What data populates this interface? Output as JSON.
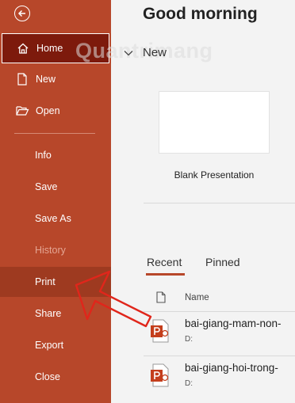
{
  "sidebar": {
    "items": [
      {
        "label": "Home"
      },
      {
        "label": "New"
      },
      {
        "label": "Open"
      },
      {
        "label": "Info"
      },
      {
        "label": "Save"
      },
      {
        "label": "Save As"
      },
      {
        "label": "History"
      },
      {
        "label": "Print"
      },
      {
        "label": "Share"
      },
      {
        "label": "Export"
      },
      {
        "label": "Close"
      }
    ]
  },
  "main": {
    "greeting": "Good morning",
    "watermark": "Quantrimang",
    "new_section": "New",
    "blank_label": "Blank Presentation",
    "tabs": [
      {
        "label": "Recent"
      },
      {
        "label": "Pinned"
      }
    ],
    "list_header": "Name",
    "files": [
      {
        "name": "bai-giang-mam-non-",
        "location": "D:"
      },
      {
        "name": "bai-giang-hoi-trong-",
        "location": "D:"
      }
    ]
  },
  "colors": {
    "sidebar": "#b7472a",
    "home_active": "#7d1a0c",
    "arrow": "#e0261b"
  },
  "icons": [
    "back-arrow-icon",
    "home-icon",
    "new-document-icon",
    "folder-open-icon",
    "chevron-down-icon",
    "document-icon",
    "powerpoint-file-icon"
  ]
}
